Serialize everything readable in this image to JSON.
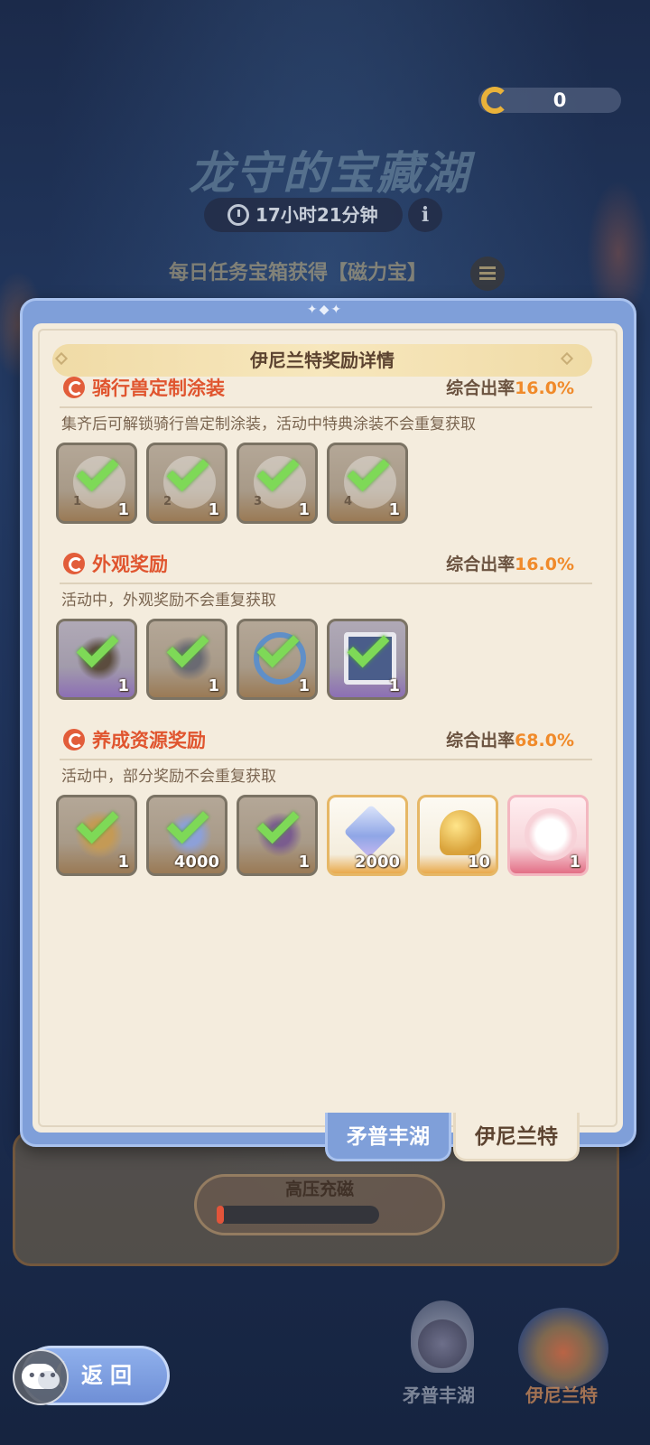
{
  "header": {
    "coin_value": "0",
    "event_title": "龙守的宝藏湖",
    "timer": "17小时21分钟",
    "info_glyph": "i",
    "daily_tip": "每日任务宝箱获得【磁力宝】"
  },
  "dialog": {
    "title": "伊尼兰特奖励详情",
    "sections": [
      {
        "title": "骑行兽定制涂装",
        "rate_label": "综合出率",
        "rate_value": "16.0%",
        "desc": "集齐后可解锁骑行兽定制涂装，活动中特典涂装不会重复获取",
        "items": [
          {
            "index": "1",
            "qty": "1",
            "claimed": true,
            "icon": "cat-coating-icon"
          },
          {
            "index": "2",
            "qty": "1",
            "claimed": true,
            "icon": "cat-coating-icon"
          },
          {
            "index": "3",
            "qty": "1",
            "claimed": true,
            "icon": "cat-coating-icon"
          },
          {
            "index": "4",
            "qty": "1",
            "claimed": true,
            "icon": "cat-coating-icon"
          }
        ]
      },
      {
        "title": "外观奖励",
        "rate_label": "综合出率",
        "rate_value": "16.0%",
        "desc": "活动中，外观奖励不会重复获取",
        "items": [
          {
            "qty": "1",
            "claimed": true,
            "icon": "ears-accessory-icon"
          },
          {
            "qty": "1",
            "claimed": true,
            "icon": "hat-accessory-icon"
          },
          {
            "qty": "1",
            "claimed": true,
            "icon": "ring-frame-icon"
          },
          {
            "qty": "1",
            "claimed": true,
            "icon": "photo-frame-icon"
          }
        ]
      },
      {
        "title": "养成资源奖励",
        "rate_label": "综合出率",
        "rate_value": "68.0%",
        "desc": "活动中，部分奖励不会重复获取",
        "items": [
          {
            "qty": "1",
            "claimed": true,
            "icon": "map-scroll-icon"
          },
          {
            "qty": "4000",
            "claimed": true,
            "icon": "star-crystal-icon"
          },
          {
            "qty": "1",
            "claimed": true,
            "icon": "armor-chest-icon"
          },
          {
            "qty": "2000",
            "claimed": false,
            "icon": "star-crystal-icon"
          },
          {
            "qty": "10",
            "claimed": false,
            "icon": "golden-bell-icon"
          },
          {
            "qty": "1",
            "claimed": false,
            "icon": "cat-avatar-icon"
          }
        ]
      }
    ],
    "tabs": [
      "矛普丰湖",
      "伊尼兰特"
    ]
  },
  "bottom": {
    "charge_label": "高压充磁",
    "charge_progress": 0.0,
    "nav": [
      "矛普丰湖",
      "伊尼兰特"
    ],
    "back_label": "返回"
  },
  "colors": {
    "accent": "#e0552f",
    "rate": "#f08a2a",
    "check": "#7ed957",
    "frame": "#7f9fd9"
  }
}
